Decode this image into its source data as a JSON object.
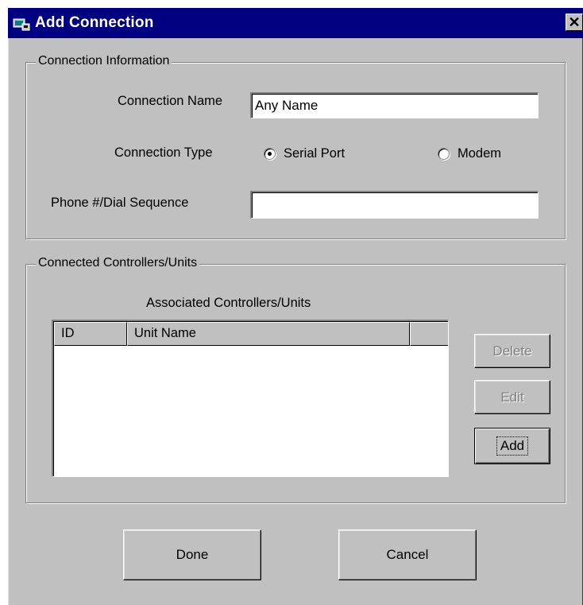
{
  "window": {
    "title": "Add Connection",
    "close_glyph": "✕",
    "icon": "connection-icon"
  },
  "connection_info": {
    "legend": "Connection Information",
    "name_label": "Connection Name",
    "name_value": "Any Name",
    "type_label": "Connection Type",
    "type_options": [
      {
        "label": "Serial Port",
        "checked": true
      },
      {
        "label": "Modem",
        "checked": false
      }
    ],
    "phone_label": "Phone #/Dial Sequence",
    "phone_value": ""
  },
  "controllers": {
    "legend": "Connected Controllers/Units",
    "list_title": "Associated Controllers/Units",
    "columns": [
      "ID",
      "Unit Name",
      ""
    ],
    "rows": [],
    "delete_label": "Delete",
    "edit_label": "Edit",
    "add_label": "Add"
  },
  "footer": {
    "done_label": "Done",
    "cancel_label": "Cancel"
  },
  "colors": {
    "titlebar": "#000080",
    "face": "#c0c0c0"
  }
}
